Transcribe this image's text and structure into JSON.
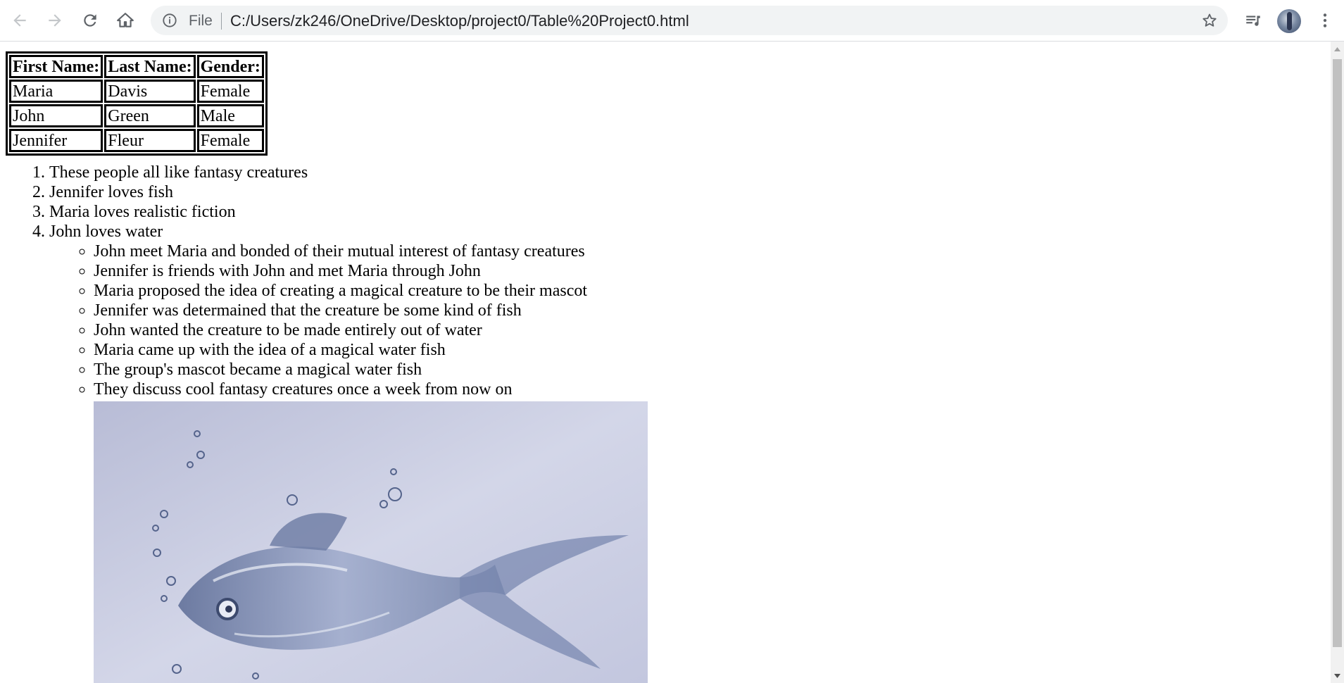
{
  "browser": {
    "omnibox_scheme": "File",
    "url": "C:/Users/zk246/OneDrive/Desktop/project0/Table%20Project0.html",
    "icons": [
      "back-icon",
      "forward-icon",
      "reload-icon",
      "home-icon",
      "info-icon",
      "star-icon",
      "media-queue-icon",
      "avatar",
      "menu-icon"
    ]
  },
  "table": {
    "headers": [
      "First Name:",
      "Last Name:",
      "Gender:"
    ],
    "rows": [
      [
        "Maria",
        "Davis",
        "Female"
      ],
      [
        "John",
        "Green",
        "Male"
      ],
      [
        "Jennifer",
        "Fleur",
        "Female"
      ]
    ]
  },
  "ordered_list": [
    "These people all like fantasy creatures",
    "Jennifer loves fish",
    "Maria loves realistic fiction",
    "John loves water"
  ],
  "nested_list": [
    "John meet Maria and bonded of their mutual interest of fantasy creatures",
    "Jennifer is friends with John and met Maria through John",
    "Maria proposed the idea of creating a magical creature to be their mascot",
    "Jennifer was determained that the creature be some kind of fish",
    "John wanted the creature to be made entirely out of water",
    "Maria came up with the idea of a magical water fish",
    "The group's mascot became a magical water fish",
    "They discuss cool fantasy creatures once a week from now on"
  ],
  "image": {
    "subject": "water-fish-image"
  },
  "colors": {
    "toolbar_icon": "#5f6368",
    "omnibox_bg": "#f1f3f4",
    "image_bg": "#c9cde0"
  }
}
